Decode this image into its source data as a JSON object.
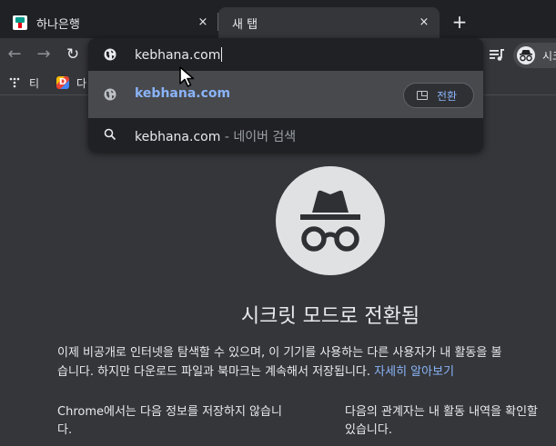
{
  "tabs": [
    {
      "title": "하나은행",
      "close": "×"
    },
    {
      "title": "새 탭",
      "close": "×"
    }
  ],
  "new_tab": "+",
  "toolbar": {
    "back": "←",
    "forward": "→",
    "reload": "↻",
    "profile_label": "시크"
  },
  "bookmarks": [
    {
      "label": "티"
    },
    {
      "label": "다",
      "icon_letter": "D"
    }
  ],
  "omnibox": {
    "input_value": "kebhana.com",
    "suggestions": [
      {
        "text": "kebhana.com",
        "action": "전환"
      },
      {
        "text": "kebhana.com",
        "separator": " - ",
        "suffix": "네이버 검색"
      }
    ]
  },
  "page": {
    "title": "시크릿 모드로 전환됨",
    "para_line1": "이제 비공개로 인터넷을 탐색할 수 있으며, 이 기기를 사용하는 다른 사용자가 내 활동을 볼",
    "para_line2": "습니다. 하지만 다운로드 파일과 북마크는 계속해서 저장됩니다.",
    "learn_more": "자세히 알아보기",
    "left_line1": "Chrome에서는 다음 정보를 저장하지 않습니",
    "left_line2": "다.",
    "right_line1": "다음의 관계자는 내 활동 내역을 확인할",
    "right_line2": "있습니다."
  },
  "colors": {
    "tabstrip": "#202124",
    "surface": "#35363a",
    "link": "#8ab4f8",
    "text": "#e8eaed"
  }
}
